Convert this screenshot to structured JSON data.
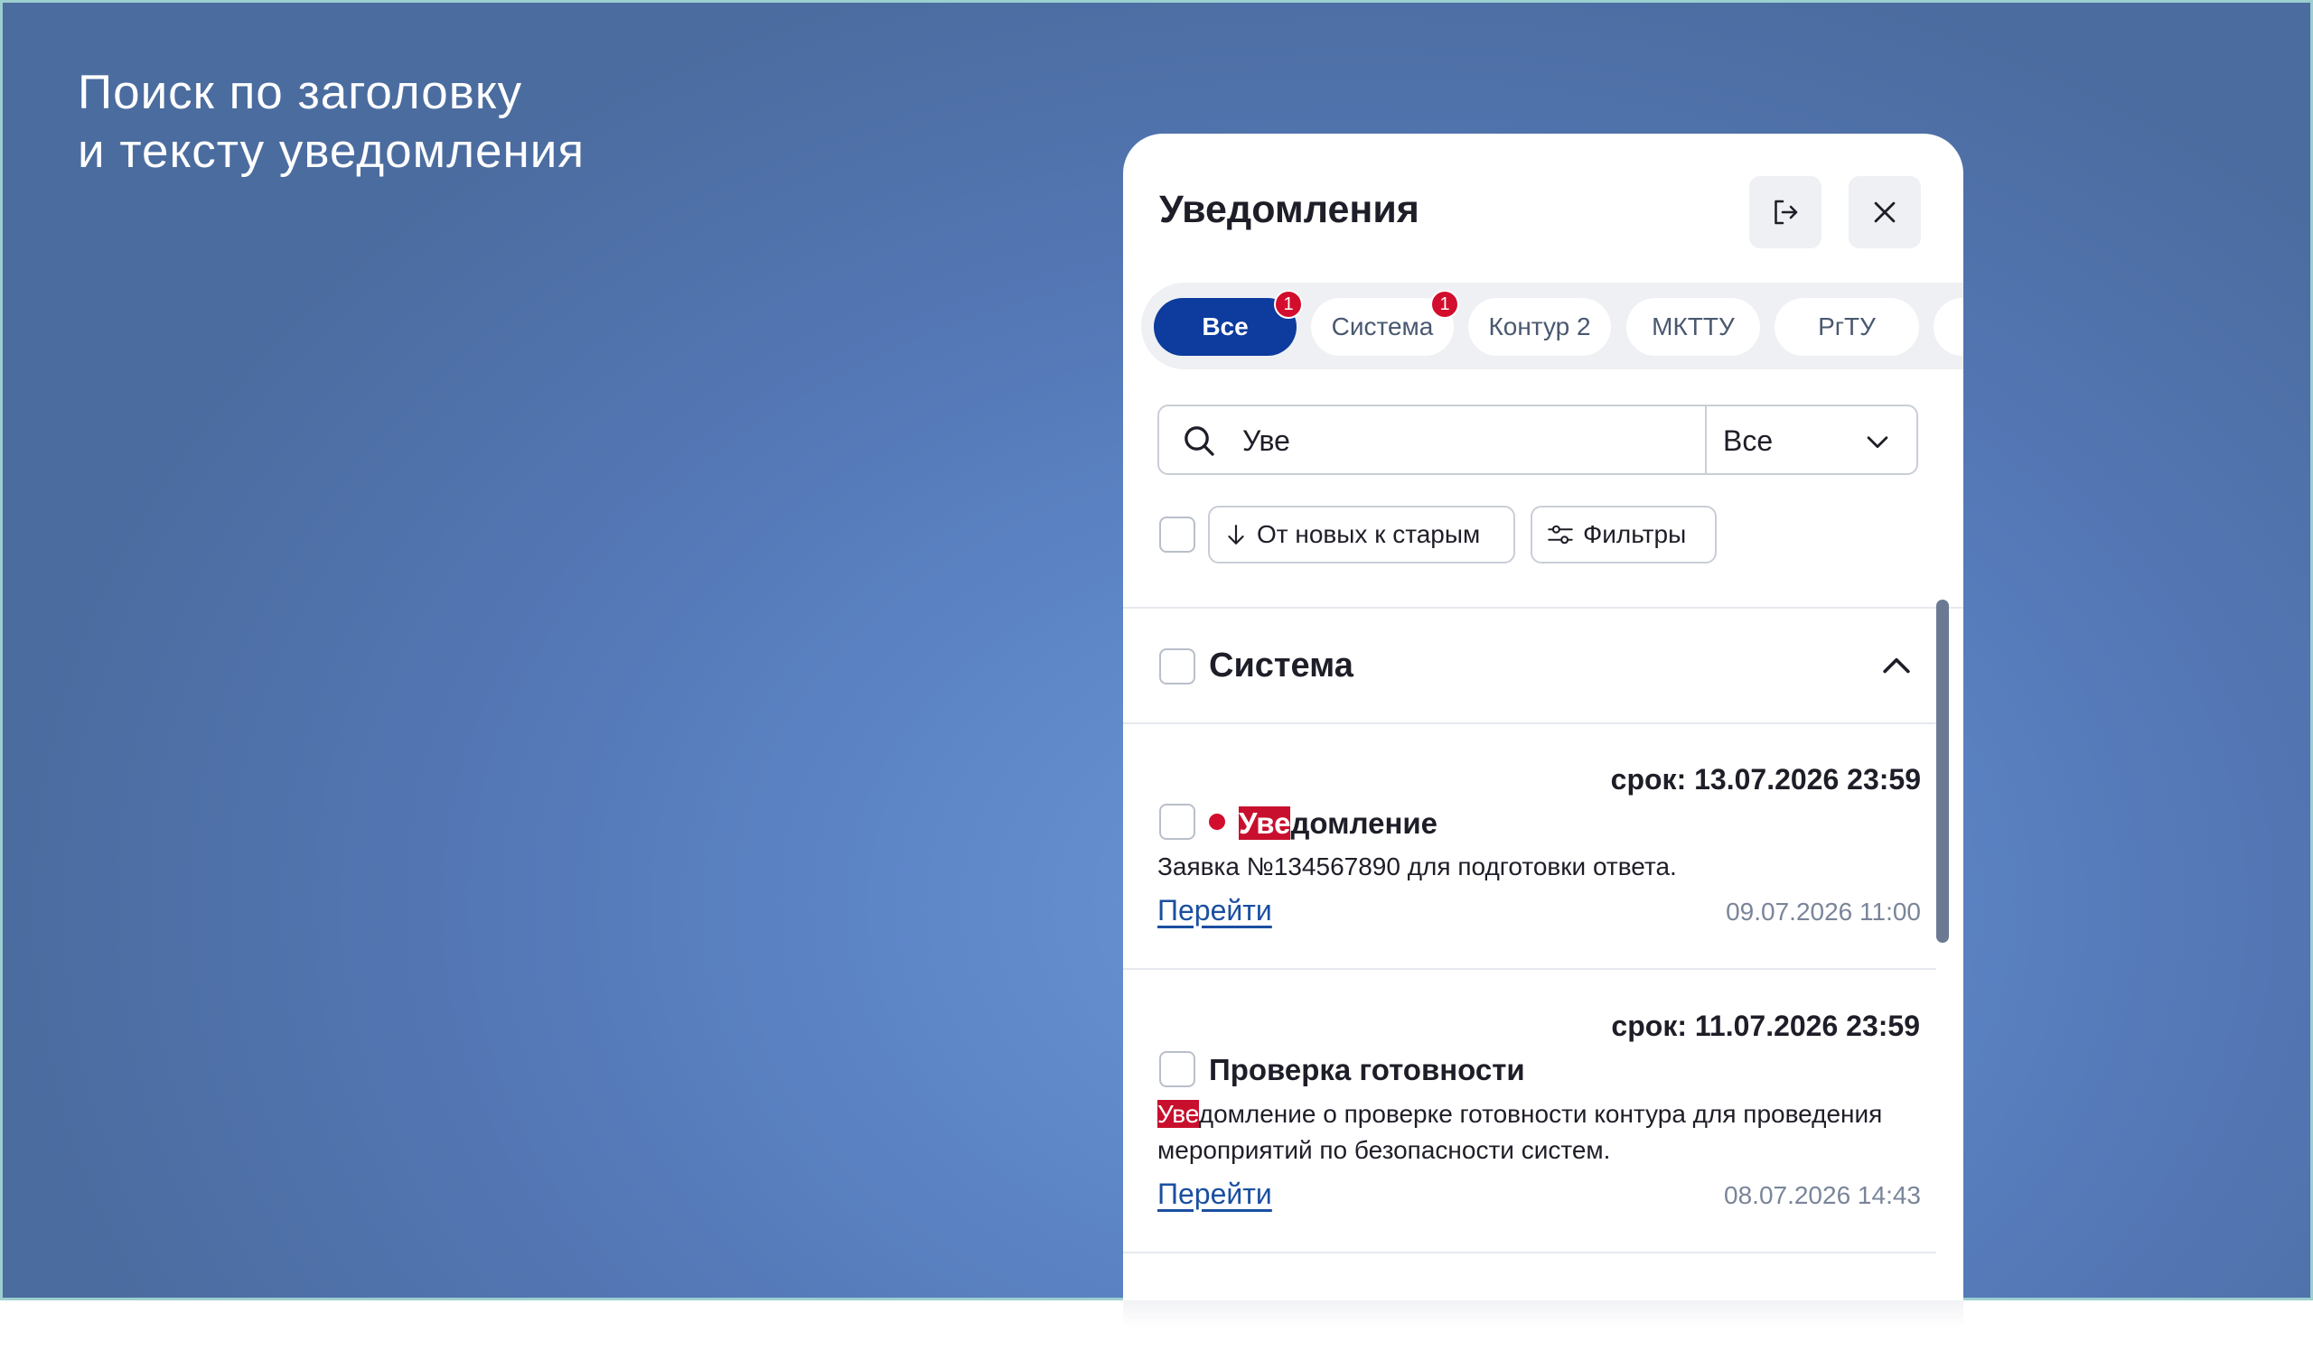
{
  "headline": {
    "line1": "Поиск по заголовку",
    "line2": "и тексту уведомления"
  },
  "panel": {
    "title": "Уведомления",
    "logout_icon": "logout-icon",
    "close_icon": "close-icon"
  },
  "tabs": [
    {
      "label": "Все",
      "active": true,
      "badge": "1"
    },
    {
      "label": "Система",
      "active": false,
      "badge": "1"
    },
    {
      "label": "Контур 2",
      "active": false
    },
    {
      "label": "МКТТУ",
      "active": false
    },
    {
      "label": "РгТУ",
      "active": false
    }
  ],
  "search": {
    "value": "Уве",
    "select_value": "Все"
  },
  "sort": {
    "label": "От новых к старым"
  },
  "filters": {
    "label": "Фильтры"
  },
  "group": {
    "title": "Система"
  },
  "notifications": [
    {
      "deadline": "срок: 13.07.2026 23:59",
      "title_highlight": "Уве",
      "title_rest": "домление",
      "unread": true,
      "body": "Заявка №134567890 для подготовки ответа.",
      "link": "Перейти",
      "date": "09.07.2026 11:00"
    },
    {
      "deadline": "срок: 11.07.2026 23:59",
      "title": "Проверка готовности",
      "body_highlight": "Уве",
      "body_rest": "домление о проверке готовности контура для проведения мероприятий по безопасности систем.",
      "link": "Перейти",
      "date": "08.07.2026 14:43"
    }
  ],
  "colors": {
    "accent": "#0d3b9e",
    "badge": "#d30d2e",
    "highlight": "#c8102e",
    "link": "#1a4fa0"
  }
}
